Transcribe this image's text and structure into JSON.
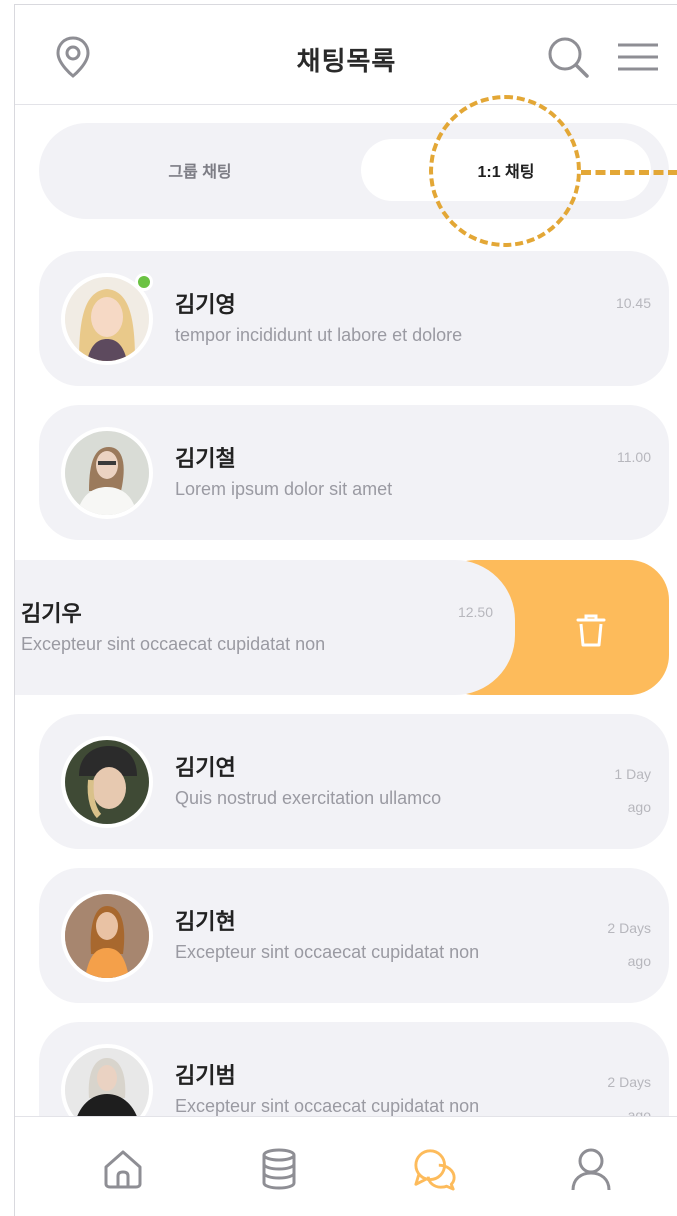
{
  "header": {
    "title": "채팅목록",
    "left_icon": "location-pin-icon",
    "right_icons": [
      "search-icon",
      "menu-icon"
    ]
  },
  "tabs": [
    {
      "label": "그룹 채팅",
      "active": false
    },
    {
      "label": "1:1 채팅",
      "active": true
    }
  ],
  "chats": [
    {
      "name": "김기영",
      "preview": "tempor incididunt ut labore et dolore",
      "time": "10.45",
      "online": true
    },
    {
      "name": "김기철",
      "preview": "Lorem ipsum dolor sit amet",
      "time": "11.00",
      "online": false
    },
    {
      "name": "김기우",
      "preview": "Excepteur sint occaecat cupidatat non",
      "time": "12.50",
      "swiped": true
    },
    {
      "name": "김기연",
      "preview": "Quis nostrud exercitation ullamco",
      "time_line1": "1 Day",
      "time_line2": "ago"
    },
    {
      "name": "김기현",
      "preview": "Excepteur sint occaecat cupidatat non",
      "time_line1": "2 Days",
      "time_line2": "ago"
    },
    {
      "name": "김기범",
      "preview": "Excepteur sint occaecat cupidatat non",
      "time_line1": "2 Days",
      "time_line2": "ago"
    }
  ],
  "delete_action": {
    "icon": "trash-icon"
  },
  "bottom_nav": [
    {
      "icon": "home-icon",
      "active": false
    },
    {
      "icon": "database-icon",
      "active": false
    },
    {
      "icon": "chat-bubbles-icon",
      "active": true
    },
    {
      "icon": "user-icon",
      "active": false
    }
  ],
  "colors": {
    "accent": "#fdbb5b",
    "highlight": "#e3a736",
    "card_bg": "#f2f2f6",
    "online": "#6bc243"
  }
}
